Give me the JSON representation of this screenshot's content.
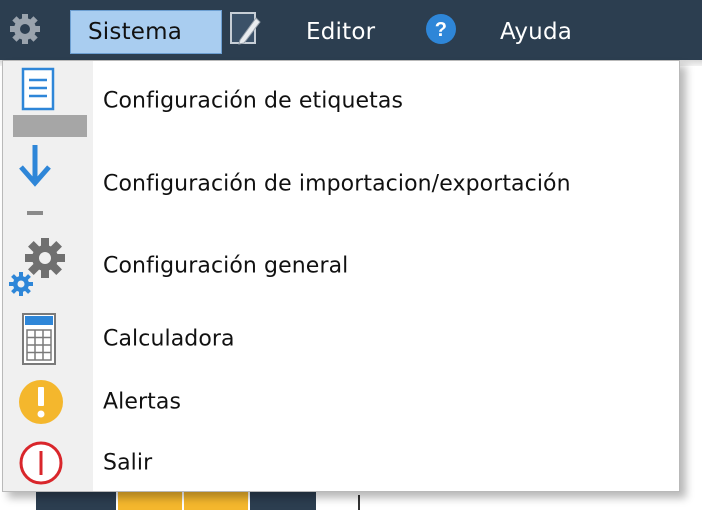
{
  "menubar": {
    "sistema_label": "Sistema",
    "editor_label": "Editor",
    "ayuda_label": "Ayuda",
    "help_glyph": "?"
  },
  "dropdown": {
    "items": [
      {
        "label": "Configuración de etiquetas",
        "icon": "label-document-icon"
      },
      {
        "label": "Configuración de importacion/exportación",
        "icon": "download-arrow-icon"
      },
      {
        "label": "Configuración general",
        "icon": "gears-icon"
      },
      {
        "label": "Calculadora",
        "icon": "calculator-icon"
      },
      {
        "label": "Alertas",
        "icon": "alert-icon"
      },
      {
        "label": "Salir",
        "icon": "power-icon"
      }
    ]
  },
  "colors": {
    "menubar_bg": "#2c3e50",
    "highlight": "#a9cdf0",
    "accent_blue": "#2e86d8",
    "alert_yellow": "#f4b72d",
    "exit_red": "#d9262b"
  }
}
